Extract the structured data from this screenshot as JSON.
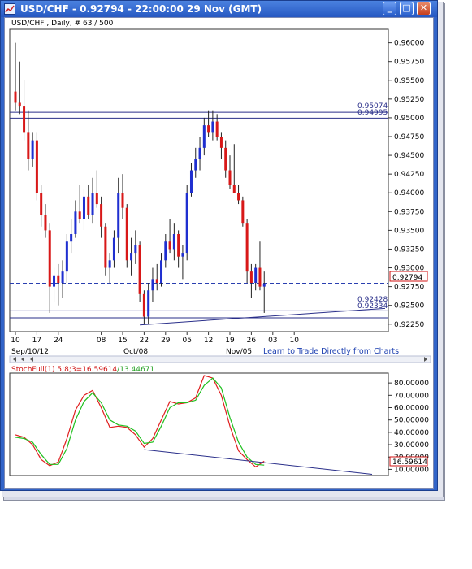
{
  "window": {
    "title": "USD/CHF - 0.92794 - 22:00:00  29 Nov (GMT)",
    "minimize_label": "_",
    "maximize_label": "□",
    "close_label": "✕"
  },
  "price_chart": {
    "header": "USD/CHF , Daily, # 63 / 500",
    "current_price_label": "0.92794",
    "line_labels": [
      "0.95074",
      "0.94995",
      "0.92428",
      "0.92334"
    ],
    "y_ticks": [
      "0.96000",
      "0.95750",
      "0.95500",
      "0.95250",
      "0.95000",
      "0.94750",
      "0.94500",
      "0.94250",
      "0.94000",
      "0.93750",
      "0.93500",
      "0.93250",
      "0.93000",
      "0.92750",
      "0.92500",
      "0.92250"
    ],
    "x_day_ticks": [
      "10",
      "17",
      "24",
      "08",
      "15",
      "22",
      "29",
      "05",
      "12",
      "19",
      "26",
      "03",
      "10"
    ],
    "x_month_labels": [
      "Sep/10/12",
      "Oct/08",
      "Nov/05"
    ],
    "link_text": "Learn to Trade Directly from Charts"
  },
  "stoch_chart": {
    "header_name": "StochFull(1) 5;8;3=",
    "k_value": "16.59614",
    "d_sep": "/",
    "d_value": "13.44671",
    "y_ticks": [
      "80.00000",
      "70.00000",
      "60.00000",
      "50.00000",
      "40.00000",
      "30.00000",
      "20.00000",
      "10.00000"
    ],
    "current_label": "16.59614"
  },
  "colors": {
    "up_candle": "#1f2fd0",
    "down_candle": "#d81818",
    "support_line": "#2a2f8a",
    "k_line": "#e02020",
    "d_line": "#20c020",
    "link": "#1c3fb0"
  },
  "chart_data": [
    {
      "type": "candlestick",
      "title": "USD/CHF , Daily",
      "ylim": [
        0.9215,
        0.9618
      ],
      "trading_days": [
        "Sep 10",
        "Sep 11",
        "Sep 12",
        "Sep 13",
        "Sep 14",
        "Sep 17",
        "Sep 18",
        "Sep 19",
        "Sep 20",
        "Sep 21",
        "Sep 24",
        "Sep 25",
        "Sep 26",
        "Sep 27",
        "Sep 28",
        "Oct 01",
        "Oct 02",
        "Oct 03",
        "Oct 04",
        "Oct 05",
        "Oct 08",
        "Oct 09",
        "Oct 10",
        "Oct 11",
        "Oct 12",
        "Oct 15",
        "Oct 16",
        "Oct 17",
        "Oct 18",
        "Oct 19",
        "Oct 22",
        "Oct 23",
        "Oct 24",
        "Oct 25",
        "Oct 26",
        "Oct 29",
        "Oct 30",
        "Oct 31",
        "Nov 01",
        "Nov 02",
        "Nov 05",
        "Nov 06",
        "Nov 07",
        "Nov 08",
        "Nov 09",
        "Nov 12",
        "Nov 13",
        "Nov 14",
        "Nov 15",
        "Nov 16",
        "Nov 19",
        "Nov 20",
        "Nov 21",
        "Nov 22",
        "Nov 23",
        "Nov 26",
        "Nov 27",
        "Nov 28",
        "Nov 29"
      ],
      "ohlc": [
        [
          0.9535,
          0.96,
          0.951,
          0.952
        ],
        [
          0.952,
          0.9575,
          0.9505,
          0.9515
        ],
        [
          0.9515,
          0.955,
          0.947,
          0.948
        ],
        [
          0.948,
          0.951,
          0.943,
          0.9445
        ],
        [
          0.9445,
          0.948,
          0.9435,
          0.947
        ],
        [
          0.947,
          0.948,
          0.939,
          0.94
        ],
        [
          0.94,
          0.941,
          0.9355,
          0.937
        ],
        [
          0.937,
          0.9385,
          0.934,
          0.935
        ],
        [
          0.935,
          0.936,
          0.924,
          0.9275
        ],
        [
          0.9275,
          0.93,
          0.9255,
          0.929
        ],
        [
          0.929,
          0.9305,
          0.925,
          0.928
        ],
        [
          0.928,
          0.931,
          0.926,
          0.9295
        ],
        [
          0.9295,
          0.9345,
          0.928,
          0.9335
        ],
        [
          0.9335,
          0.9365,
          0.932,
          0.9345
        ],
        [
          0.9345,
          0.939,
          0.934,
          0.9375
        ],
        [
          0.9375,
          0.941,
          0.936,
          0.9365
        ],
        [
          0.9365,
          0.9405,
          0.935,
          0.9395
        ],
        [
          0.9395,
          0.941,
          0.9365,
          0.937
        ],
        [
          0.937,
          0.942,
          0.936,
          0.94
        ],
        [
          0.94,
          0.943,
          0.938,
          0.9385
        ],
        [
          0.9385,
          0.9395,
          0.934,
          0.9355
        ],
        [
          0.9355,
          0.936,
          0.929,
          0.93
        ],
        [
          0.93,
          0.932,
          0.928,
          0.931
        ],
        [
          0.931,
          0.935,
          0.93,
          0.934
        ],
        [
          0.934,
          0.942,
          0.932,
          0.94
        ],
        [
          0.94,
          0.9425,
          0.9365,
          0.938
        ],
        [
          0.938,
          0.9385,
          0.93,
          0.931
        ],
        [
          0.931,
          0.934,
          0.929,
          0.932
        ],
        [
          0.932,
          0.935,
          0.9305,
          0.933
        ],
        [
          0.933,
          0.9335,
          0.9255,
          0.9265
        ],
        [
          0.9265,
          0.927,
          0.9225,
          0.9235
        ],
        [
          0.9235,
          0.928,
          0.9225,
          0.927
        ],
        [
          0.927,
          0.93,
          0.9255,
          0.9285
        ],
        [
          0.9285,
          0.9305,
          0.927,
          0.928
        ],
        [
          0.928,
          0.932,
          0.9275,
          0.931
        ],
        [
          0.931,
          0.9345,
          0.93,
          0.9335
        ],
        [
          0.9335,
          0.9365,
          0.932,
          0.9325
        ],
        [
          0.9325,
          0.936,
          0.931,
          0.9345
        ],
        [
          0.9345,
          0.935,
          0.93,
          0.9315
        ],
        [
          0.9315,
          0.933,
          0.9285,
          0.932
        ],
        [
          0.932,
          0.941,
          0.931,
          0.94
        ],
        [
          0.94,
          0.944,
          0.9395,
          0.943
        ],
        [
          0.943,
          0.946,
          0.942,
          0.9445
        ],
        [
          0.9445,
          0.9475,
          0.943,
          0.946
        ],
        [
          0.946,
          0.95,
          0.945,
          0.949
        ],
        [
          0.949,
          0.951,
          0.9475,
          0.948
        ],
        [
          0.948,
          0.951,
          0.947,
          0.9495
        ],
        [
          0.9495,
          0.9505,
          0.947,
          0.9475
        ],
        [
          0.9475,
          0.948,
          0.9445,
          0.946
        ],
        [
          0.946,
          0.947,
          0.942,
          0.943
        ],
        [
          0.943,
          0.945,
          0.9405,
          0.941
        ],
        [
          0.941,
          0.9465,
          0.94,
          0.94
        ],
        [
          0.94,
          0.941,
          0.9385,
          0.939
        ],
        [
          0.939,
          0.9395,
          0.9355,
          0.936
        ],
        [
          0.936,
          0.9365,
          0.928,
          0.9295
        ],
        [
          0.9295,
          0.9305,
          0.926,
          0.928
        ],
        [
          0.928,
          0.9305,
          0.927,
          0.93
        ],
        [
          0.93,
          0.9335,
          0.927,
          0.9275
        ],
        [
          0.9275,
          0.9295,
          0.924,
          0.9279
        ]
      ],
      "horizontal_lines": [
        0.95074,
        0.94995,
        0.92794,
        0.92428,
        0.92334
      ],
      "trendline": {
        "from": [
          "Oct 19",
          0.9224
        ],
        "to": [
          "Nov 29",
          0.9243
        ]
      }
    },
    {
      "type": "line",
      "title": "StochFull(1) 5;8;3",
      "ylim": [
        5,
        88
      ],
      "x": [
        "Sep 10",
        "Sep 12",
        "Sep 14",
        "Sep 18",
        "Sep 20",
        "Sep 24",
        "Sep 26",
        "Sep 28",
        "Oct 02",
        "Oct 04",
        "Oct 08",
        "Oct 10",
        "Oct 12",
        "Oct 16",
        "Oct 18",
        "Oct 22",
        "Oct 24",
        "Oct 26",
        "Oct 30",
        "Nov 01",
        "Nov 05",
        "Nov 07",
        "Nov 09",
        "Nov 13",
        "Nov 15",
        "Nov 19",
        "Nov 21",
        "Nov 23",
        "Nov 27",
        "Nov 29"
      ],
      "series": [
        {
          "name": "%K",
          "values": [
            38,
            36,
            30,
            18,
            13,
            16,
            35,
            58,
            70,
            74,
            60,
            44,
            45,
            44,
            38,
            28,
            35,
            50,
            65,
            63,
            64,
            68,
            86,
            84,
            70,
            45,
            25,
            18,
            12,
            16.6
          ]
        },
        {
          "name": "%D",
          "values": [
            36,
            35,
            32,
            22,
            14,
            14,
            27,
            50,
            65,
            72,
            64,
            50,
            46,
            45,
            41,
            31,
            32,
            45,
            60,
            64,
            64,
            66,
            78,
            84,
            76,
            52,
            32,
            20,
            14,
            13.4
          ]
        }
      ],
      "trendline": {
        "from": [
          "Oct 22",
          26
        ],
        "to": [
          "Nov 29",
          5
        ]
      }
    }
  ]
}
